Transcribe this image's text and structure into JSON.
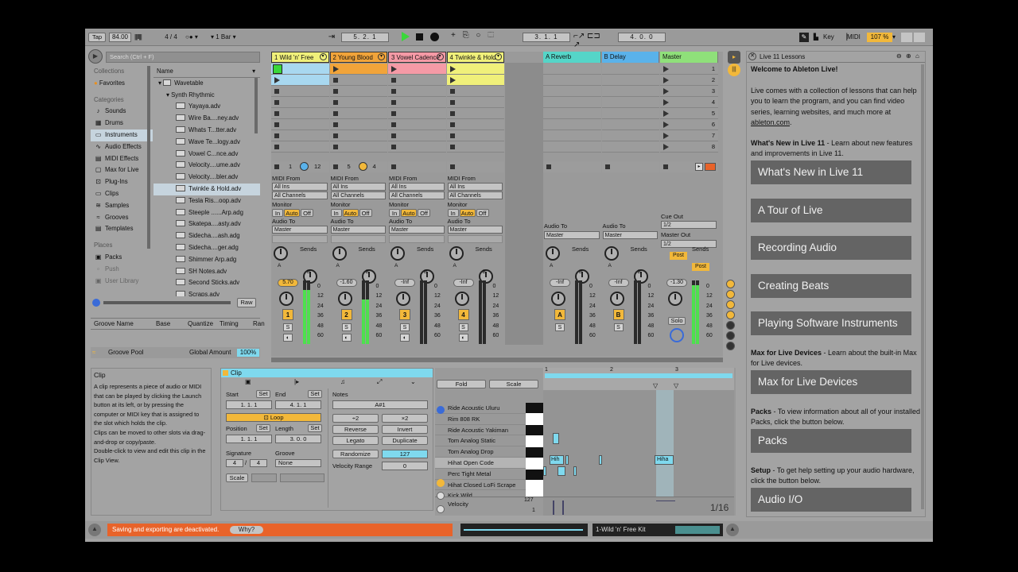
{
  "toolbar": {
    "tap": "Tap",
    "bpm": "84.00",
    "meter_num": "4",
    "meter_den": "4",
    "quantize": "1 Bar",
    "position": "5.   2.   1",
    "loop_start": "3.   1.   1",
    "loop_length": "4.   0.   0",
    "key": "Key",
    "midi": "MIDI",
    "cpu": "107 %"
  },
  "browser": {
    "search_placeholder": "Search (Ctrl + F)",
    "collections_header": "Collections",
    "favorites": "Favorites",
    "categories_header": "Categories",
    "categories": [
      {
        "icon": "note-icon",
        "label": "Sounds"
      },
      {
        "icon": "drum-icon",
        "label": "Drums"
      },
      {
        "icon": "instrument-icon",
        "label": "Instruments"
      },
      {
        "icon": "audio-effect-icon",
        "label": "Audio Effects"
      },
      {
        "icon": "midi-effect-icon",
        "label": "MIDI Effects"
      },
      {
        "icon": "max-icon",
        "label": "Max for Live"
      },
      {
        "icon": "plug-icon",
        "label": "Plug-Ins"
      },
      {
        "icon": "clip-icon",
        "label": "Clips"
      },
      {
        "icon": "wave-icon",
        "label": "Samples"
      },
      {
        "icon": "groove-icon",
        "label": "Grooves"
      },
      {
        "icon": "template-icon",
        "label": "Templates"
      }
    ],
    "places_header": "Places",
    "places": [
      {
        "icon": "pack-icon",
        "label": "Packs"
      },
      {
        "icon": "push-icon",
        "label": "Push"
      },
      {
        "icon": "user-library-icon",
        "label": "User Library"
      }
    ],
    "name_header": "Name",
    "tree": [
      {
        "level": 0,
        "label": "Wavetable"
      },
      {
        "level": 1,
        "label": "Synth Rhythmic"
      }
    ],
    "files": [
      "Yayaya.adv",
      "Wire Ba....ney.adv",
      "Whats T...tter.adv",
      "Wave Te...logy.adv",
      "Vowel C...nce.adv",
      "Velocity....ume.adv",
      "Velocity....bler.adv",
      "Twinkle & Hold.adv",
      "Tesla Ris...oop.adv",
      "Steeple ......Arp.adg",
      "Skatepa....asty.adv",
      "Sidecha....ash.adg",
      "Sidecha....ger.adg",
      "Shimmer Arp.adg",
      "SH Notes.adv",
      "Second Sticks.adv",
      "Scraps.adv"
    ],
    "raw": "Raw"
  },
  "groove": {
    "headers": [
      "Groove Name",
      "Base",
      "Quantize",
      "Timing",
      "Ran"
    ],
    "pool": "Groove Pool",
    "global_amount_label": "Global Amount",
    "global_amount": "100%"
  },
  "info": {
    "title": "Clip",
    "text": "A clip represents a piece of audio or MIDI that can be played by clicking the Launch button at its left, or by pressing the computer or MIDI key that is assigned to the slot which holds the clip.\nClips can be moved to other slots via drag-and-drop or copy/paste.\nDouble-click to view and edit this clip in the Clip View."
  },
  "tracks": [
    {
      "name": "1 Wild 'n' Free",
      "color": "#f0f07a",
      "number": "1",
      "volume": "5.70",
      "midi_from": "MIDI From",
      "input": "All Ins",
      "channel": "All Channels",
      "audio_to": "Audio To",
      "output": "Master"
    },
    {
      "name": "2 Young Blood",
      "color": "#f1a43a",
      "number": "2",
      "volume": "-1.60",
      "midi_from": "MIDI From",
      "input": "All Ins",
      "channel": "All Channels",
      "audio_to": "Audio To",
      "output": "Master"
    },
    {
      "name": "3 Vowel Cadence",
      "color": "#f59aa6",
      "number": "3",
      "volume": "-Inf",
      "midi_from": "MIDI From",
      "input": "All Ins",
      "channel": "All Channels",
      "audio_to": "Audio To",
      "output": "Master"
    },
    {
      "name": "4 Twinkle & Hold",
      "color": "#f0f07a",
      "number": "4",
      "volume": "-Inf",
      "midi_from": "MIDI From",
      "input": "All Ins",
      "channel": "All Channels",
      "audio_to": "Audio To",
      "output": "Master"
    }
  ],
  "returns": [
    {
      "name": "A Reverb",
      "color": "#55d5c8",
      "letter": "A",
      "volume": "-Inf",
      "output": "Master"
    },
    {
      "name": "B Delay",
      "color": "#5ab2ea",
      "letter": "B",
      "volume": "-Inf",
      "output": "Master"
    }
  ],
  "master": {
    "name": "Master",
    "color": "#8fe07a",
    "volume": "-1.30",
    "cue_out_label": "Cue Out",
    "cue_out": "1/2",
    "master_out_label": "Master Out",
    "master_out": "1/2",
    "solo": "Solo",
    "post": "Post"
  },
  "scenes": [
    "1",
    "2",
    "3",
    "4",
    "5",
    "6",
    "7",
    "8"
  ],
  "mixer_labels": {
    "monitor": "Monitor",
    "in": "In",
    "auto": "Auto",
    "off": "Off",
    "sends": "Sends",
    "s": "S",
    "scale": [
      "0",
      "12",
      "24",
      "36",
      "48",
      "60"
    ],
    "track1_sub": "1",
    "track1_sub2": "12",
    "track2_sub": "5",
    "track2_sub2": "4"
  },
  "clip": {
    "tab_title": "Clip",
    "start": "Start",
    "end": "End",
    "set": "Set",
    "start_val": "1.   1.   1",
    "end_val": "4.   1.   1",
    "loop": "Loop",
    "position": "Position",
    "length": "Length",
    "position_val": "1.   1.   1",
    "length_val": "3.   0.   0",
    "signature": "Signature",
    "groove": "Groove",
    "sig_num": "4",
    "sig_den": "4",
    "groove_val": "None",
    "scale": "Scale",
    "notes": "Notes",
    "note_val": "A#1",
    "half": "÷2",
    "double": "×2",
    "reverse": "Reverse",
    "invert": "Invert",
    "legato": "Legato",
    "duplicate": "Duplicate",
    "randomize": "Randomize",
    "rand_val": "127",
    "velocity_range": "Velocity Range",
    "vel_range_val": "0",
    "fold": "Fold",
    "scale_btn": "Scale",
    "rows": [
      "Ride Acoustic Uluru",
      "Rim 808 RK",
      "Ride Acoustic Yakiman",
      "Tom Analog Static",
      "Tom Analog Drop",
      "Hihat Open Code",
      "Perc Tight Metal",
      "Hihat Closed LoFi Scrape",
      "Kick Wild"
    ],
    "ruler": [
      "1",
      "2",
      "3"
    ],
    "note_labels": [
      "Hih",
      "Hiha"
    ],
    "velocity": "Velocity",
    "vel_max": "127",
    "vel_min": "1",
    "grid": "1/16"
  },
  "lessons": {
    "title": "Live 11 Lessons",
    "welcome": "Welcome to Ableton Live!",
    "intro": "Live comes with a collection of lessons that can help you to learn the program, and you can find video series, learning websites, and much more at ",
    "link": "ableton.com",
    "whats_new_bold": "What's New in Live 11",
    "whats_new_text": " - Learn about new features and improvements in Live 11.",
    "buttons": [
      "What's New in Live 11",
      "A Tour of Live",
      "Recording Audio",
      "Creating Beats",
      "Playing Software Instruments"
    ],
    "m4l_bold": "Max for Live Devices",
    "m4l_text": " - Learn about the built-in Max for Live devices.",
    "m4l_button": "Max for Live Devices",
    "packs_bold": "Packs",
    "packs_text": " - To view information about all of your installed Packs, click the button below.",
    "packs_button": "Packs",
    "setup_bold": "Setup",
    "setup_text": " - To get help setting up your audio hardware, click the button below.",
    "setup_button": "Audio I/O"
  },
  "status": {
    "message": "Saving and exporting are deactivated.",
    "why": "Why?",
    "clip_name": "1-Wild 'n' Free Kit"
  }
}
